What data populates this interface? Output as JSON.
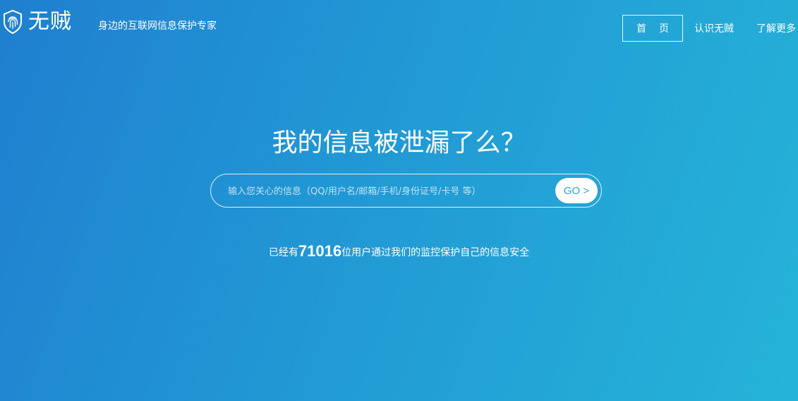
{
  "header": {
    "logo_text": "无贼",
    "slogan": "身边的互联网信息保护专家",
    "nav": {
      "home": "首页",
      "about": "认识无贼",
      "more": "了解更多"
    }
  },
  "main": {
    "title": "我的信息被泄漏了么？",
    "search": {
      "placeholder": "输入您关心的信息（QQ/用户名/邮箱/手机/身份证号/卡号 等）",
      "value": "",
      "go_label": "GO >"
    },
    "stats": {
      "prefix": "已经有",
      "count": "71016",
      "suffix": "位用户通过我们的监控保护自己的信息安全"
    }
  },
  "icons": {
    "logo": "fingerprint-shield-icon"
  },
  "colors": {
    "gradient_start": "#1f7fd0",
    "gradient_end": "#25b4d8",
    "go_text": "#2ea4d7"
  }
}
